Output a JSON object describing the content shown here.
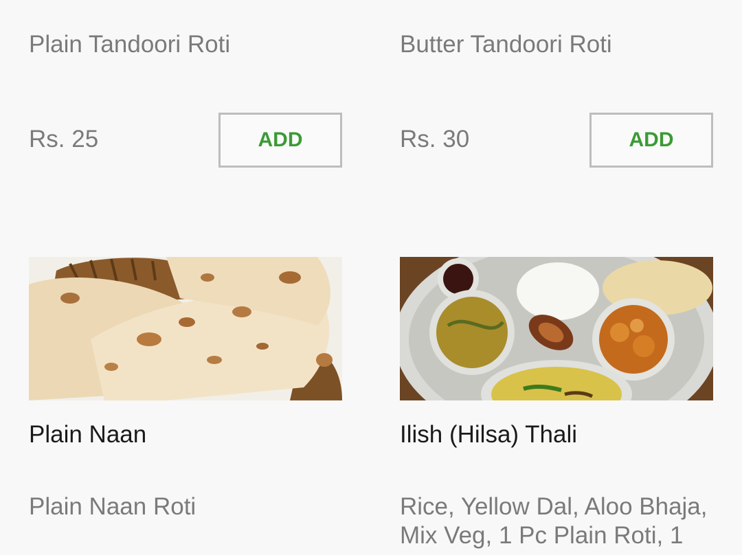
{
  "items": [
    {
      "description": "Plain Tandoori Roti",
      "price": "Rs. 25",
      "add_label": "ADD"
    },
    {
      "description": "Butter Tandoori Roti",
      "price": "Rs. 30",
      "add_label": "ADD"
    },
    {
      "name": "Plain Naan",
      "description": "Plain Naan Roti"
    },
    {
      "name": "Ilish (Hilsa) Thali",
      "description": "Rice, Yellow Dal, Aloo Bhaja, Mix Veg, 1 Pc Plain Roti, 1"
    }
  ],
  "colors": {
    "accent": "#3b9b35",
    "muted_text": "#7a7a7a",
    "title_text": "#1a1a1a",
    "button_border": "#bdbdbd",
    "background": "#f8f8f8"
  }
}
